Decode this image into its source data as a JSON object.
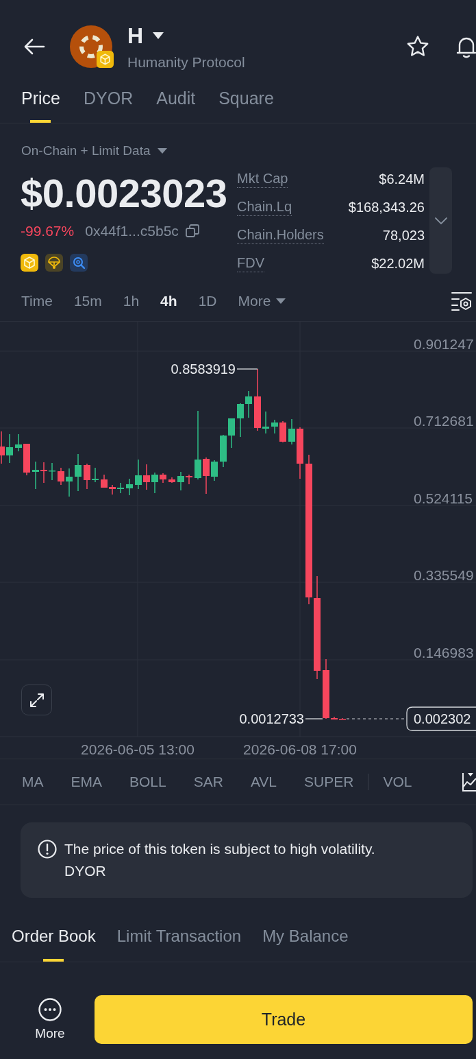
{
  "header": {
    "symbol": "H",
    "name": "Humanity Protocol"
  },
  "tabs": [
    {
      "label": "Price",
      "selected": true
    },
    {
      "label": "DYOR",
      "selected": false
    },
    {
      "label": "Audit",
      "selected": false
    },
    {
      "label": "Square",
      "selected": false
    }
  ],
  "data_source": "On-Chain + Limit Data",
  "price": {
    "value": "$0.0023023",
    "change": "-99.67%",
    "contract": "0x44f1...c5b5c"
  },
  "stats": [
    {
      "label": "Mkt Cap",
      "value": "$6.24M"
    },
    {
      "label": "Chain.Lq",
      "value": "$168,343.26"
    },
    {
      "label": "Chain.Holders",
      "value": "78,023"
    },
    {
      "label": "FDV",
      "value": "$22.02M"
    }
  ],
  "intervals": [
    {
      "label": "Time",
      "kind": "option",
      "selected": false
    },
    {
      "label": "15m",
      "kind": "option",
      "selected": false
    },
    {
      "label": "1h",
      "kind": "option",
      "selected": false
    },
    {
      "label": "4h",
      "kind": "option",
      "selected": true
    },
    {
      "label": "1D",
      "kind": "option",
      "selected": false
    },
    {
      "label": "More",
      "kind": "dropdown",
      "selected": false
    }
  ],
  "chart": {
    "y_axis_labels": [
      "0.901247",
      "0.712681",
      "0.524115",
      "0.335549",
      "0.146983"
    ],
    "x_axis_labels": [
      "2026-06-05 13:00",
      "2026-06-08 17:00"
    ],
    "high_label": "0.8583919",
    "low_label": "0.0012733",
    "current_price_tag": "0.002302"
  },
  "indicators": {
    "main": [
      "MA",
      "EMA",
      "BOLL",
      "SAR",
      "AVL",
      "SUPER"
    ],
    "sub": [
      "VOL"
    ]
  },
  "notice": "The price of this token is subject to high volatility. DYOR",
  "bottom_tabs": [
    {
      "label": "Order Book",
      "selected": true
    },
    {
      "label": "Limit Transaction",
      "selected": false
    },
    {
      "label": "My Balance",
      "selected": false
    }
  ],
  "actions": {
    "more": "More",
    "trade": "Trade"
  }
}
